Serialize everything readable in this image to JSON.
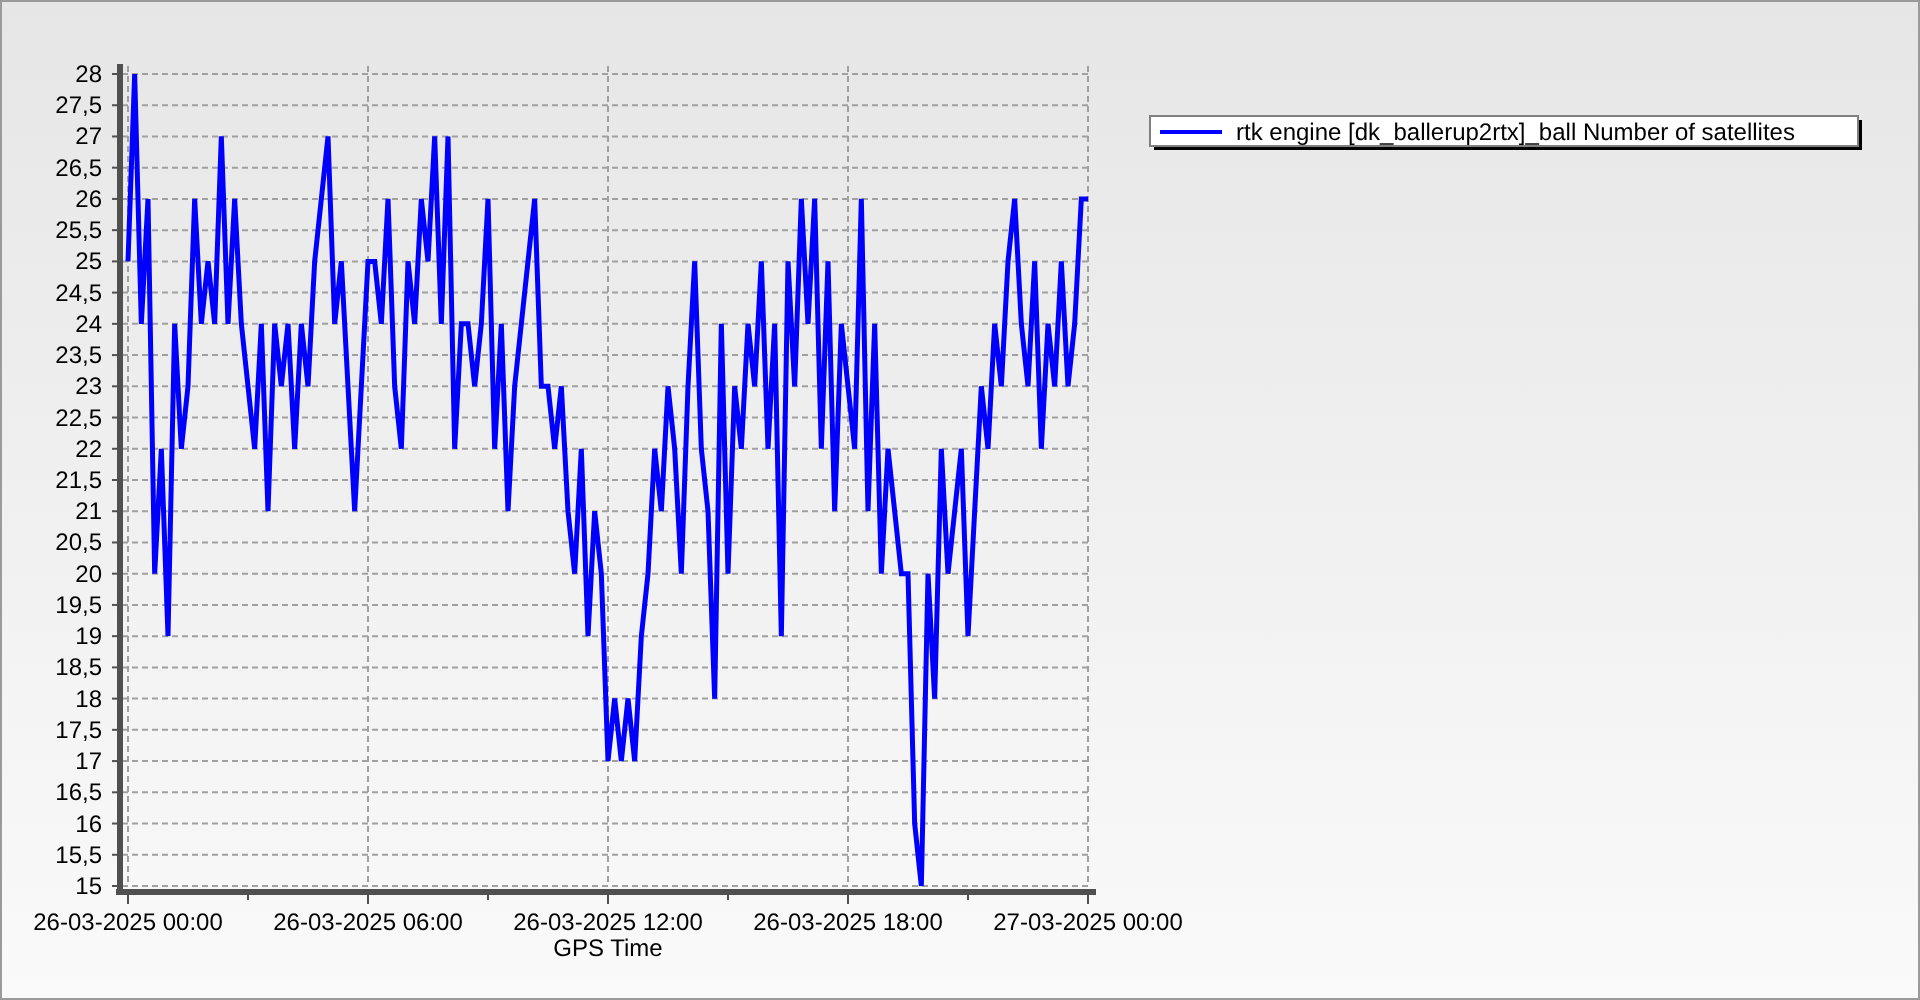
{
  "chart": {
    "chart_data": {
      "type": "line",
      "xlabel": "GPS Time",
      "categories": [
        "26-03-2025 00:00",
        null,
        null,
        null,
        null,
        null,
        null,
        null,
        null,
        null,
        null,
        null,
        null,
        null,
        null,
        null,
        null,
        null,
        null,
        null,
        null,
        null,
        null,
        null,
        null,
        null,
        null,
        null,
        null,
        null,
        null,
        null,
        null,
        null,
        null,
        null,
        "26-03-2025 06:00",
        null,
        null,
        null,
        null,
        null,
        null,
        null,
        null,
        null,
        null,
        null,
        null,
        null,
        null,
        null,
        null,
        null,
        null,
        null,
        null,
        null,
        null,
        null,
        null,
        null,
        null,
        null,
        null,
        null,
        null,
        null,
        null,
        null,
        null,
        null,
        "26-03-2025 12:00",
        null,
        null,
        null,
        null,
        null,
        null,
        null,
        null,
        null,
        null,
        null,
        null,
        null,
        null,
        null,
        null,
        null,
        null,
        null,
        null,
        null,
        null,
        null,
        null,
        null,
        null,
        null,
        null,
        null,
        null,
        null,
        null,
        null,
        null,
        null,
        "26-03-2025 18:00",
        null,
        null,
        null,
        null,
        null,
        null,
        null,
        null,
        null,
        null,
        null,
        null,
        null,
        null,
        null,
        null,
        null,
        null,
        null,
        null,
        null,
        null,
        null,
        null,
        null,
        null,
        null,
        null,
        null,
        null,
        null,
        null,
        null,
        null,
        null,
        "27-03-2025 00:00"
      ],
      "series": [
        {
          "name": "rtk engine [dk_ballerup2rtx]_ball Number of satellites",
          "color": "#0000ff",
          "values": [
            25,
            28,
            24,
            26,
            20,
            22,
            19,
            24,
            22,
            23,
            26,
            24,
            25,
            24,
            27,
            24,
            26,
            24,
            23,
            22,
            24,
            21,
            24,
            23,
            24,
            22,
            24,
            23,
            25,
            26,
            27,
            24,
            25,
            23,
            21,
            23,
            25,
            25,
            24,
            26,
            23,
            22,
            25,
            24,
            26,
            25,
            27,
            24,
            27,
            22,
            24,
            24,
            23,
            24,
            26,
            22,
            24,
            21,
            23,
            24,
            25,
            26,
            23,
            23,
            22,
            23,
            21,
            20,
            22,
            19,
            21,
            20,
            17,
            18,
            17,
            18,
            17,
            19,
            20,
            22,
            21,
            23,
            22,
            20,
            23,
            25,
            22,
            21,
            18,
            24,
            20,
            23,
            22,
            24,
            23,
            25,
            22,
            24,
            19,
            25,
            23,
            26,
            24,
            26,
            22,
            25,
            21,
            24,
            23,
            22,
            26,
            21,
            24,
            20,
            22,
            21,
            20,
            20,
            16,
            15,
            20,
            18,
            22,
            20,
            21,
            22,
            19,
            21,
            23,
            22,
            24,
            23,
            25,
            26,
            24,
            23,
            25,
            22,
            24,
            23,
            25,
            23,
            24,
            26,
            26
          ]
        }
      ],
      "ylim": [
        15,
        28
      ],
      "grid": true,
      "yticks": [
        15,
        {
          "value": 15.5,
          "label": "15,5"
        },
        16,
        {
          "value": 16.5,
          "label": "16,5"
        },
        17,
        {
          "value": 17.5,
          "label": "17,5"
        },
        18,
        {
          "value": 18.5,
          "label": "18,5"
        },
        19,
        {
          "value": 19.5,
          "label": "19,5"
        },
        20,
        {
          "value": 20.5,
          "label": "20,5"
        },
        21,
        {
          "value": 21.5,
          "label": "21,5"
        },
        22,
        {
          "value": 22.5,
          "label": "22,5"
        },
        23,
        {
          "value": 23.5,
          "label": "23,5"
        },
        24,
        {
          "value": 24.5,
          "label": "24,5"
        },
        25,
        {
          "value": 25.5,
          "label": "25,5"
        },
        26,
        {
          "value": 26.5,
          "label": "26,5"
        },
        27,
        {
          "value": 27.5,
          "label": "27,5"
        },
        28
      ]
    }
  }
}
